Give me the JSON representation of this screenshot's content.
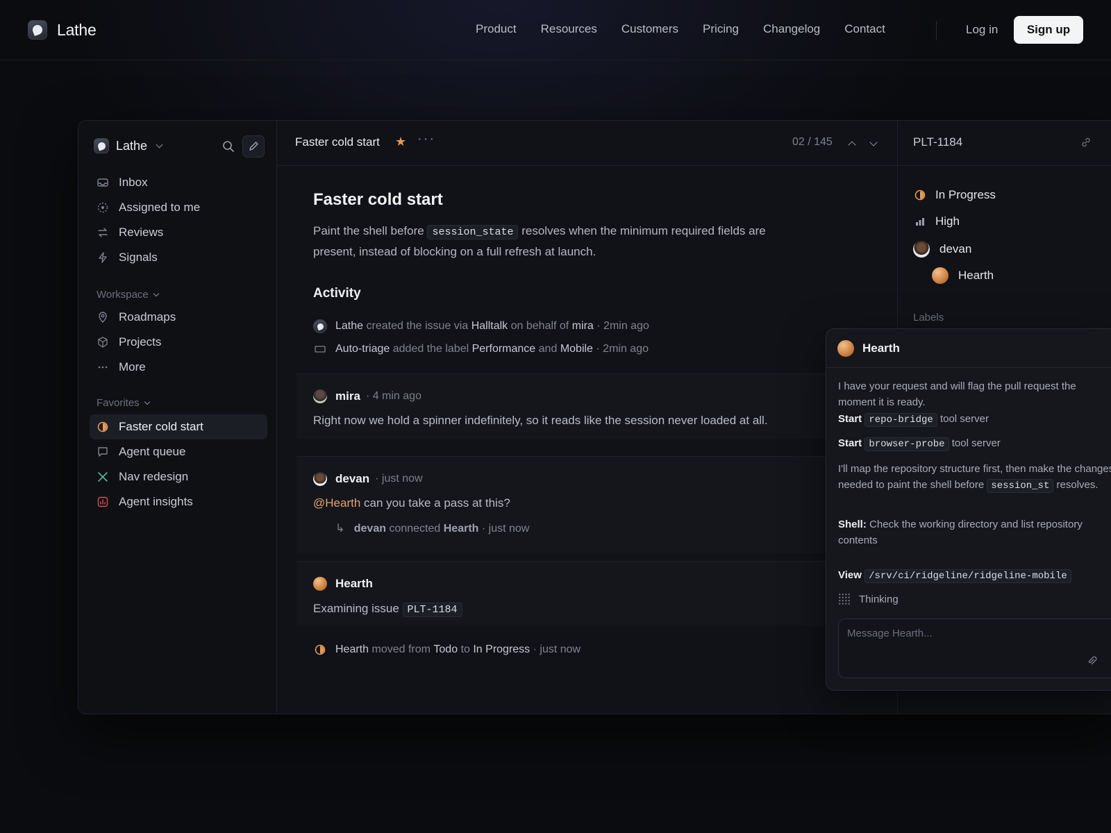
{
  "site": {
    "brand": "Lathe",
    "nav": [
      "Product",
      "Resources",
      "Customers",
      "Pricing",
      "Changelog",
      "Contact"
    ],
    "login": "Log in",
    "signup": "Sign up"
  },
  "sidebar": {
    "workspace": "Lathe",
    "top_items": [
      {
        "label": "Inbox",
        "icon": "inbox-icon"
      },
      {
        "label": "Assigned to me",
        "icon": "assigned-icon"
      },
      {
        "label": "Reviews",
        "icon": "reviews-icon"
      },
      {
        "label": "Signals",
        "icon": "lightning-icon"
      }
    ],
    "workspace_header": "Workspace",
    "workspace_items": [
      {
        "label": "Roadmaps",
        "icon": "map-pin-icon"
      },
      {
        "label": "Projects",
        "icon": "cube-icon"
      },
      {
        "label": "More",
        "icon": "more-icon"
      }
    ],
    "favorites_header": "Favorites",
    "favorites": [
      {
        "label": "Faster cold start",
        "icon": "in-progress-icon",
        "active": true
      },
      {
        "label": "Agent queue",
        "icon": "chat-icon"
      },
      {
        "label": "Nav redesign",
        "icon": "x-icon"
      },
      {
        "label": "Agent insights",
        "icon": "chart-icon"
      }
    ]
  },
  "issue": {
    "header_title": "Faster cold start",
    "position": "02 / 145",
    "title": "Faster cold start",
    "desc_before": "Paint the shell before",
    "desc_code": "session_state",
    "desc_after": "resolves when the minimum required fields are present, instead of blocking on a full refresh at launch.",
    "activity_title": "Activity",
    "activity": [
      {
        "actor": "Lathe",
        "t1": "created the issue via",
        "v1": "Halltalk",
        "t2": "on behalf of",
        "v2": "mira",
        "time": "· 2min ago"
      },
      {
        "actor": "Auto-triage",
        "t1": "added the label",
        "v1": "Performance",
        "t2": "and",
        "v2": "Mobile",
        "time": "· 2min ago"
      }
    ],
    "comment1": {
      "author": "mira",
      "time": "· 4 min ago",
      "text": "Right now we hold a spinner indefinitely, so it reads like the session never loaded at all."
    },
    "comment2": {
      "author": "devan",
      "time": "· just now",
      "mention": "@Hearth",
      "text": "can you take a pass at this?",
      "sub_actor": "devan",
      "sub_text": "connected",
      "sub_target": "Hearth",
      "sub_time": "· just now"
    },
    "comment3": {
      "author": "Hearth",
      "text": "Examining issue",
      "code": "PLT-1184"
    },
    "move": {
      "actor": "Hearth",
      "t1": "moved from",
      "from": "Todo",
      "t2": "to",
      "to": "In Progress",
      "time": "· just now"
    }
  },
  "panel": {
    "id": "PLT-1184",
    "status": "In Progress",
    "priority": "High",
    "assignee": "devan",
    "agent": "Hearth",
    "labels_header": "Labels"
  },
  "chat": {
    "agent": "Hearth",
    "msg1": "I have your request and will flag the pull request the moment it is ready.",
    "start1_label": "Start",
    "start1_code": "repo-bridge",
    "start1_suffix": "tool server",
    "start2_label": "Start",
    "start2_code": "browser-probe",
    "start2_suffix": "tool server",
    "msg2_before": "I'll map the repository structure first, then make the changes needed to paint the shell before",
    "msg2_code": "session_st",
    "msg2_after": "resolves.",
    "shell_label": "Shell:",
    "shell_text": "Check the working directory and list repository contents",
    "view_label": "View",
    "view_code": "/srv/ci/ridgeline/ridgeline-mobile",
    "thinking": "Thinking",
    "input_placeholder": "Message Hearth..."
  },
  "colors": {
    "accent": "#e49a55",
    "background": "#0b0c0f",
    "panel": "#111217",
    "signup_bg": "#f3f4f6"
  }
}
